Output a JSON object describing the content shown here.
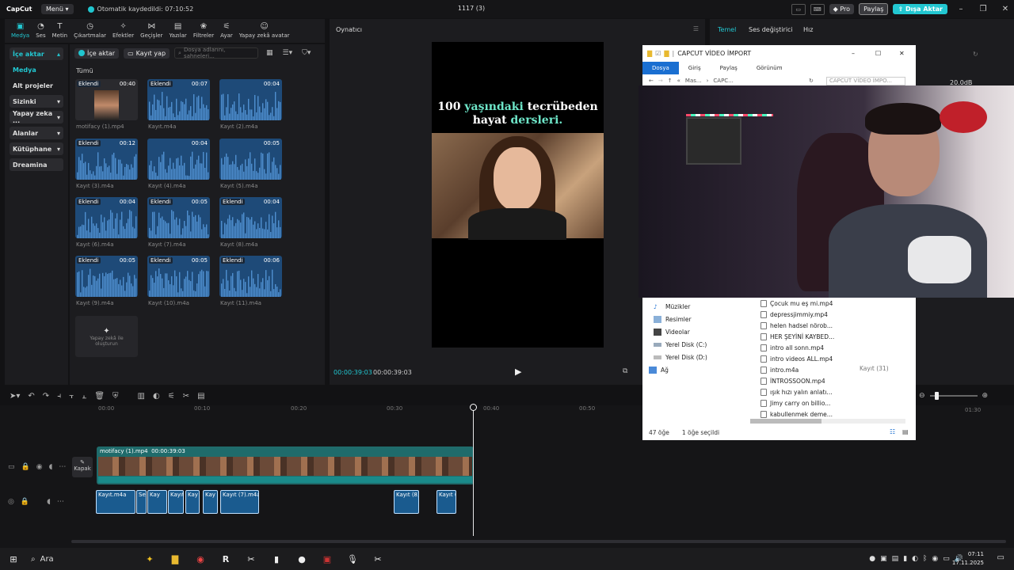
{
  "app": {
    "logo": "CapCut",
    "menu_label": "Menü",
    "autosave": "Otomatik kaydedildi: 07:10:52",
    "project_title": "1117 (3)",
    "pro_label": "Pro",
    "share_label": "Paylaş",
    "export_label": "Dışa Aktar"
  },
  "toolbar": {
    "items": [
      {
        "label": "Medya",
        "icon": "media-icon"
      },
      {
        "label": "Ses",
        "icon": "audio-icon"
      },
      {
        "label": "Metin",
        "icon": "text-icon"
      },
      {
        "label": "Çıkartmalar",
        "icon": "sticker-icon"
      },
      {
        "label": "Efektler",
        "icon": "effects-icon"
      },
      {
        "label": "Geçişler",
        "icon": "transition-icon"
      },
      {
        "label": "Yazılar",
        "icon": "captions-icon"
      },
      {
        "label": "Filtreler",
        "icon": "filters-icon"
      },
      {
        "label": "Ayar",
        "icon": "adjust-icon"
      },
      {
        "label": "Yapay zekâ avatar",
        "icon": "ai-avatar-icon"
      }
    ]
  },
  "leftnav": {
    "items": [
      {
        "label": "İçe aktar",
        "caret": "▴"
      },
      {
        "label": "Medya",
        "caret": ""
      },
      {
        "label": "Alt projeler",
        "caret": ""
      },
      {
        "label": "Sizinki",
        "caret": "▾"
      },
      {
        "label": "Yapay zeka ...",
        "caret": "▾"
      },
      {
        "label": "Alanlar",
        "caret": "▾"
      },
      {
        "label": "Kütüphane",
        "caret": "▾"
      },
      {
        "label": "Dreamina",
        "caret": ""
      }
    ]
  },
  "media": {
    "import_btn": "İçe aktar",
    "record_btn": "Kayıt yap",
    "search_placeholder": "Dosya adlarını, sahneleri...",
    "filter_label": "Tümü",
    "items": [
      {
        "name": "motifacy (1).mp4",
        "badge": "Eklendi",
        "duration": "00:40"
      },
      {
        "name": "Kayıt.m4a",
        "badge": "Eklendi",
        "duration": "00:07"
      },
      {
        "name": "Kayıt (2).m4a",
        "badge": "",
        "duration": "00:04"
      },
      {
        "name": "Kayıt (3).m4a",
        "badge": "Eklendi",
        "duration": "00:12"
      },
      {
        "name": "Kayıt (4).m4a",
        "badge": "",
        "duration": "00:04"
      },
      {
        "name": "Kayıt (5).m4a",
        "badge": "",
        "duration": "00:05"
      },
      {
        "name": "Kayıt (6).m4a",
        "badge": "Eklendi",
        "duration": "00:04"
      },
      {
        "name": "Kayıt (7).m4a",
        "badge": "Eklendi",
        "duration": "00:05"
      },
      {
        "name": "Kayıt (8).m4a",
        "badge": "Eklendi",
        "duration": "00:04"
      },
      {
        "name": "Kayıt (9).m4a",
        "badge": "Eklendi",
        "duration": "00:05"
      },
      {
        "name": "Kayıt (10).m4a",
        "badge": "Eklendi",
        "duration": "00:05"
      },
      {
        "name": "Kayıt (11).m4a",
        "badge": "Eklendi",
        "duration": "00:06"
      }
    ],
    "ai_card": "Yapay zekâ ile oluşturun"
  },
  "player": {
    "title": "Oynatıcı",
    "headline_a": "100 ",
    "headline_hl": "yaşındaki",
    "headline_b": " tecrübeden",
    "headline_c": "hayat ",
    "headline_hl2": "dersleri.",
    "current_time": "00:00:39:03",
    "total_time": "00:00:39:03"
  },
  "rightpanel": {
    "tabs": [
      "Temel",
      "Ses değiştirici",
      "Hız"
    ],
    "volume": "20.0dB"
  },
  "timeline": {
    "ruler": [
      "00:00",
      "00:10",
      "00:20",
      "00:30",
      "00:40",
      "00:50",
      "01:30"
    ],
    "video_clip": {
      "name": "motifacy (1).mp4",
      "duration": "00:00:39:03"
    },
    "cover_label": "Kapak",
    "audio_clips": [
      "Kayıt.m4a",
      "Se",
      "Kay",
      "Kayıt (",
      "Kay",
      "Kay",
      "",
      "Kayıt (7).m4a",
      "Kayıt (8).",
      "Kayıt ("
    ]
  },
  "explorer": {
    "title": "CAPCUT VİDEO İMPORT",
    "ribbon": [
      "Dosya",
      "Giriş",
      "Paylaş",
      "Görünüm"
    ],
    "address": [
      "Mas...",
      "CAPC..."
    ],
    "search_placeholder": "CAPCUT VİDEO İMPO...",
    "nav": [
      "Müzikler",
      "Resimler",
      "Videolar",
      "Yerel Disk (C:)",
      "Yerel Disk (D:)",
      "Ağ"
    ],
    "files": [
      "Çocuk mu eş mi.mp4",
      "depressjimmiy.mp4",
      "helen  hadsel nörob...",
      "HER ŞEYİNİ KAYBED...",
      "intro all sonn.mp4",
      "intro videos ALL.mp4",
      "intro.m4a",
      "İNTROSSOON.mp4",
      "ışık hızı yalın anlatı...",
      "Jimy carry on billio...",
      "kabullenmek deme..."
    ],
    "kayit31": "Kayıt (31)",
    "status_count": "47 öğe",
    "status_selected": "1 öğe seçildi"
  },
  "taskbar": {
    "search": "Ara",
    "time": "07:11",
    "date": "17.11.2025"
  },
  "colors": {
    "accent": "#22c7d1",
    "audio_clip": "#1a5b8f",
    "video_track": "#1f6b6b"
  }
}
